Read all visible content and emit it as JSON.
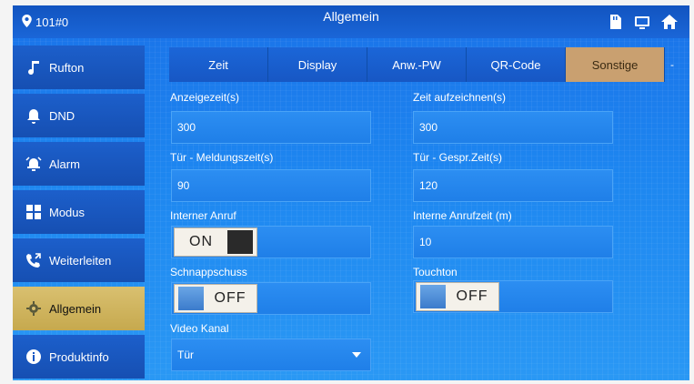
{
  "header": {
    "room": "101#0",
    "title": "Allgemein",
    "icons": [
      "sd-card-icon",
      "monitor-icon",
      "home-icon"
    ]
  },
  "sidebar": {
    "items": [
      {
        "label": "Rufton",
        "icon": "music-note-icon"
      },
      {
        "label": "DND",
        "icon": "bell-icon"
      },
      {
        "label": "Alarm",
        "icon": "alarm-icon"
      },
      {
        "label": "Modus",
        "icon": "grid-icon"
      },
      {
        "label": "Weiterleiten",
        "icon": "phone-forward-icon"
      },
      {
        "label": "Allgemein",
        "icon": "gear-icon",
        "active": true
      },
      {
        "label": "Produktinfo",
        "icon": "info-icon"
      }
    ]
  },
  "tabs": {
    "items": [
      "Zeit",
      "Display",
      "Anw.-PW",
      "QR-Code",
      "Sonstige"
    ],
    "active": "Sonstige",
    "more": "-"
  },
  "form": {
    "anzeigezeit": {
      "label": "Anzeigezeit(s)",
      "value": "300"
    },
    "zeit_aufzeichnen": {
      "label": "Zeit aufzeichnen(s)",
      "value": "300"
    },
    "tuer_meldungszeit": {
      "label": "Tür - Meldungszeit(s)",
      "value": "90"
    },
    "tuer_gespr_zeit": {
      "label": "Tür - Gespr.Zeit(s)",
      "value": "120"
    },
    "interner_anruf": {
      "label": "Interner Anruf",
      "state": "ON"
    },
    "interne_anrufzeit": {
      "label": "Interne Anrufzeit (m)",
      "value": "10"
    },
    "schnappschuss": {
      "label": "Schnappschuss",
      "state": "OFF"
    },
    "touchton": {
      "label": "Touchton",
      "state": "OFF"
    },
    "video_kanal": {
      "label": "Video Kanal",
      "value": "Tür"
    }
  },
  "colors": {
    "screen_blue": "#1d86f0",
    "active_sidebar": "#d9c070",
    "active_tab": "#c9a070"
  }
}
